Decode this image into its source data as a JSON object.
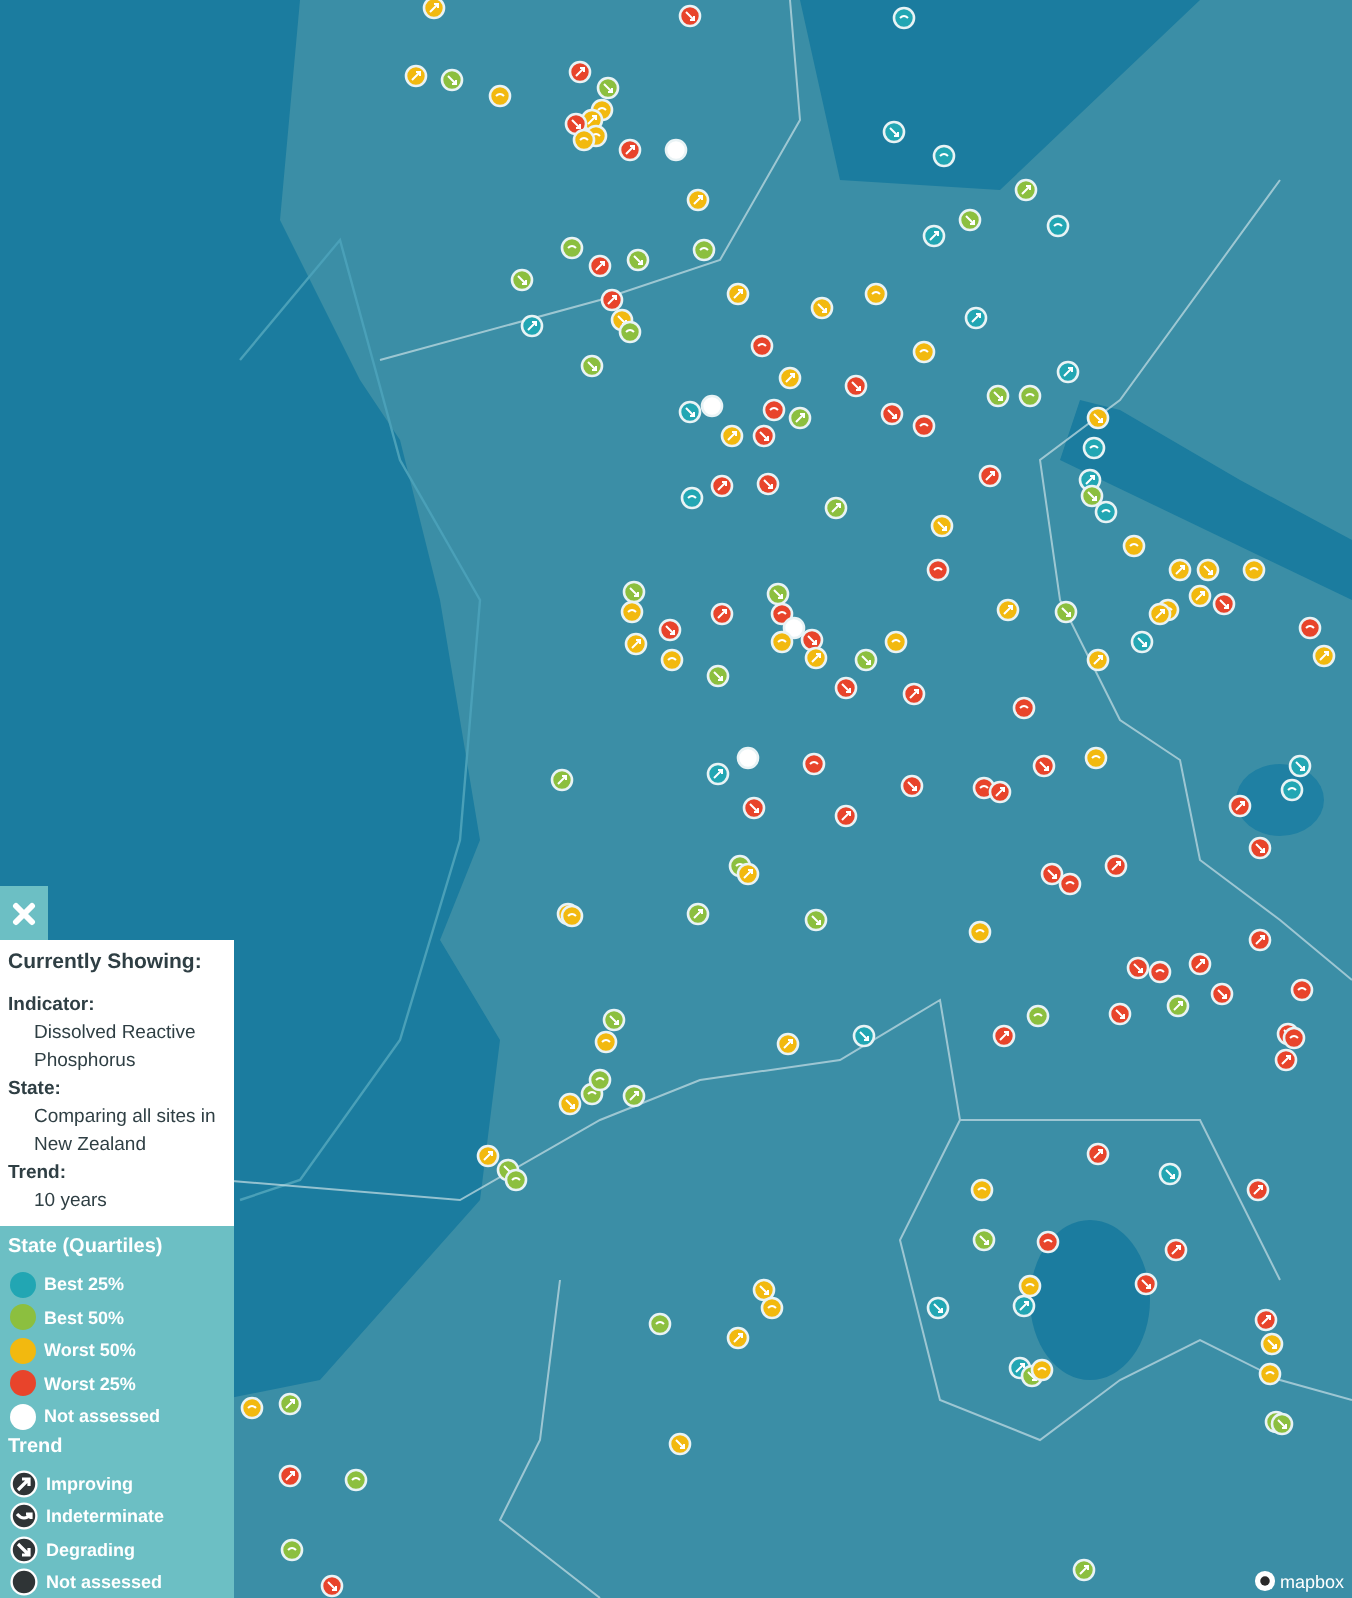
{
  "legend": {
    "currently_showing": {
      "title": "Currently Showing:",
      "fields": [
        {
          "label": "Indicator:",
          "value": "Dissolved Reactive Phosphorus"
        },
        {
          "label": "State:",
          "value": "Comparing all sites in New Zealand"
        },
        {
          "label": "Trend:",
          "value": "10 years"
        }
      ]
    },
    "state": {
      "title": "State (Quartiles)",
      "items": [
        {
          "label": "Best 25%",
          "color": "#22a6b3"
        },
        {
          "label": "Best 50%",
          "color": "#8cbf3f"
        },
        {
          "label": "Worst 50%",
          "color": "#f2b90f"
        },
        {
          "label": "Worst 25%",
          "color": "#e8442b"
        },
        {
          "label": "Not assessed",
          "color": "#ffffff"
        }
      ]
    },
    "trend": {
      "title": "Trend",
      "items": [
        {
          "label": "Improving",
          "kind": "improving"
        },
        {
          "label": "Indeterminate",
          "kind": "indeterminate"
        },
        {
          "label": "Degrading",
          "kind": "degrading"
        },
        {
          "label": "Not assessed",
          "kind": "none"
        }
      ]
    }
  },
  "attribution": "mapbox"
}
